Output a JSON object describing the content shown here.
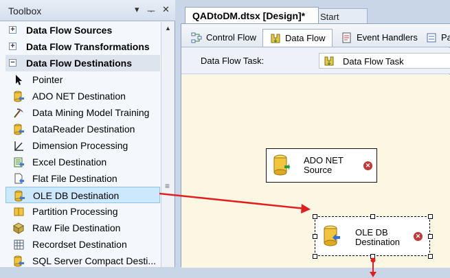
{
  "toolbox": {
    "title": "Toolbox",
    "controls": {
      "dropdown": "▾",
      "pin": "ᅮ",
      "close": "✕"
    },
    "categories": [
      {
        "label": "Data Flow Sources",
        "state": "+"
      },
      {
        "label": "Data Flow Transformations",
        "state": "+"
      },
      {
        "label": "Data Flow Destinations",
        "state": "−"
      }
    ],
    "items": [
      {
        "label": "Pointer",
        "icon": "pointer-icon"
      },
      {
        "label": "ADO NET Destination",
        "icon": "ado-net-destination-icon"
      },
      {
        "label": "Data Mining Model Training",
        "icon": "data-mining-icon"
      },
      {
        "label": "DataReader Destination",
        "icon": "datareader-destination-icon"
      },
      {
        "label": "Dimension Processing",
        "icon": "dimension-processing-icon"
      },
      {
        "label": "Excel Destination",
        "icon": "excel-destination-icon"
      },
      {
        "label": "Flat File Destination",
        "icon": "flat-file-destination-icon"
      },
      {
        "label": "OLE DB Destination",
        "icon": "ole-db-destination-icon",
        "selected": true
      },
      {
        "label": "Partition Processing",
        "icon": "partition-processing-icon"
      },
      {
        "label": "Raw File Destination",
        "icon": "raw-file-destination-icon"
      },
      {
        "label": "Recordset Destination",
        "icon": "recordset-destination-icon"
      },
      {
        "label": "SQL Server Compact Desti...",
        "icon": "sql-server-compact-icon"
      }
    ]
  },
  "document": {
    "tabs": [
      {
        "label": "QADtoDM.dtsx [Design]*",
        "active": true
      },
      {
        "label": "Start Page",
        "active": false
      }
    ],
    "designer_tabs": [
      {
        "label": "Control Flow",
        "icon": "control-flow-icon"
      },
      {
        "label": "Data Flow",
        "icon": "data-flow-icon",
        "selected": true
      },
      {
        "label": "Event Handlers",
        "icon": "event-handlers-icon"
      },
      {
        "label": "Pa",
        "icon": "package-explorer-icon"
      }
    ],
    "task_label": "Data Flow Task:",
    "task_value": "Data Flow Task",
    "components": [
      {
        "line1": "ADO NET",
        "line2": "Source",
        "status": "error"
      },
      {
        "line1": "OLE DB",
        "line2": "Destination",
        "status": "error",
        "selected": true
      }
    ]
  },
  "colors": {
    "canvas": "#fbf7e2",
    "selection": "#cce8ff",
    "drag_arrow": "#e02020",
    "error": "#c03838"
  }
}
